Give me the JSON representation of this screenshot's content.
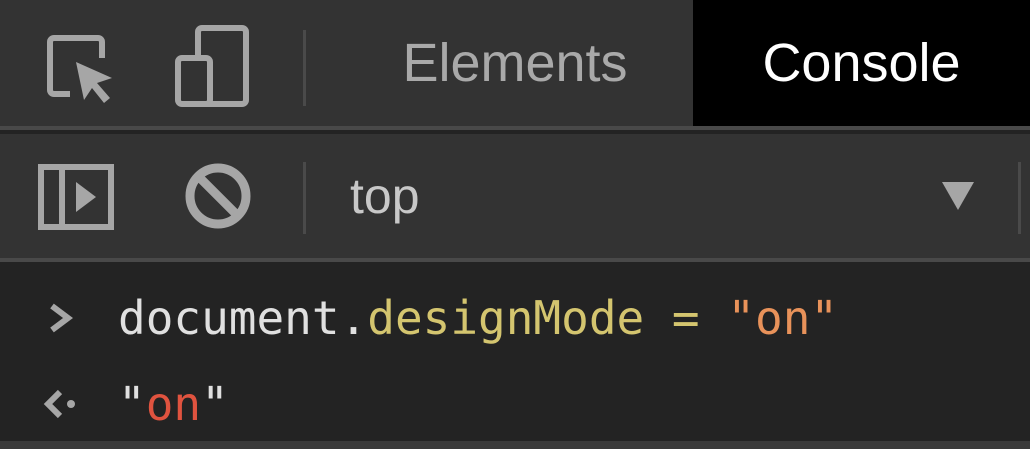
{
  "tabs": {
    "elements": "Elements",
    "console": "Console",
    "active": "console"
  },
  "toolbar": {
    "context": "top"
  },
  "console": {
    "input": {
      "object": "document",
      "dot": ".",
      "property": "designMode",
      "operator": " = ",
      "value_open_quote": "\"",
      "value": "on",
      "value_close_quote": "\""
    },
    "output": {
      "open_quote": "\"",
      "value": "on",
      "close_quote": "\""
    }
  },
  "icons": {
    "inspect": "inspect-element-icon",
    "device": "device-toolbar-icon",
    "sidebar": "console-sidebar-icon",
    "clear": "clear-console-icon",
    "dropdown": "chevron-down-icon",
    "input_prompt": "chevron-right-icon",
    "output_prompt": "return-arrow-icon"
  },
  "colors": {
    "panel": "#333333",
    "background": "#232323",
    "active_tab": "#000000",
    "property": "#d4c56f",
    "string": "#e8925a",
    "result": "#e0533f"
  }
}
